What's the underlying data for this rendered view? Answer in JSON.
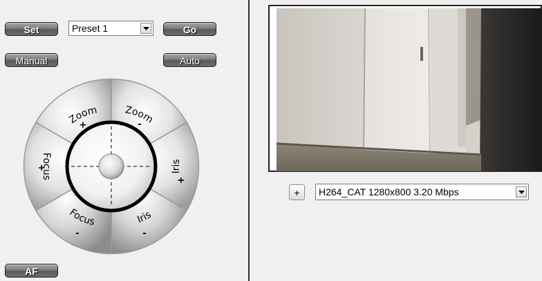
{
  "presets": {
    "set_label": "Set",
    "selected": "Preset 1",
    "go_label": "Go"
  },
  "mode": {
    "manual_label": "Manual",
    "auto_label": "Auto"
  },
  "ptz_dial": {
    "zoom_in_label": "Zoom",
    "zoom_in_sign": "+",
    "zoom_out_label": "Zoom",
    "zoom_out_sign": "-",
    "iris_open_label": "Iris",
    "iris_open_sign": "+",
    "iris_close_label": "Iris",
    "iris_close_sign": "-",
    "focus_near_label": "Focus",
    "focus_near_sign": "+",
    "focus_far_label": "Focus",
    "focus_far_sign": "-"
  },
  "af_label": "AF",
  "stream": {
    "add_label": "+",
    "selected": "H264_CAT 1280x800 3.20 Mbps"
  },
  "icons": {
    "dropdown": "chevron-down-icon",
    "crosshair": "crosshair-icon"
  },
  "colors": {
    "background": "#f0f0f0",
    "button": "#6f6f6f",
    "divider": "#2b2b2b"
  }
}
